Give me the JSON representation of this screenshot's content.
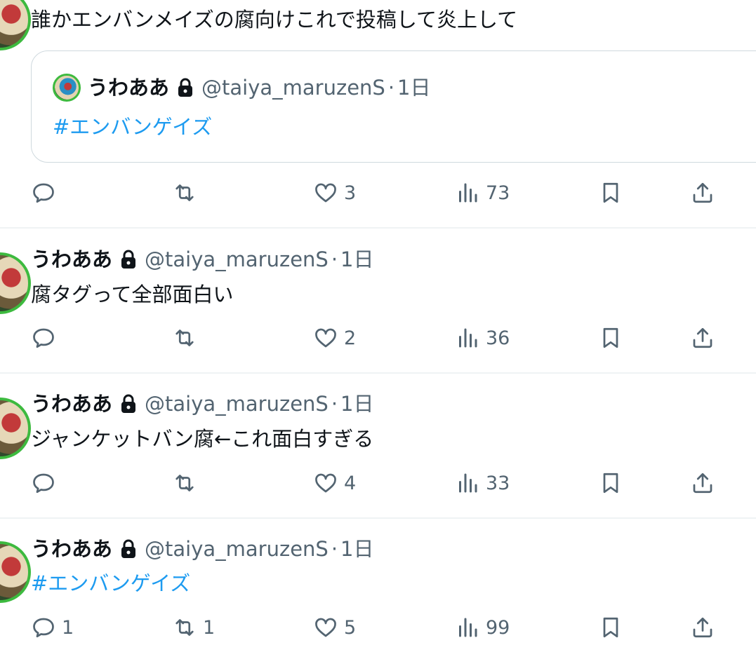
{
  "colors": {
    "text": "#0f1419",
    "secondary": "#536471",
    "hashtag": "#1d9bf0",
    "avatar_ring": "#3dba3f",
    "divider": "#eff3f4"
  },
  "post0": {
    "text": "誰かエンバンメイズの腐向けこれで投稿して炎上して",
    "quote": {
      "display_name": "うわああ",
      "handle": "@taiya_maruzenS",
      "sep": "·",
      "time": "1日",
      "text": "#エンバンゲイズ"
    },
    "reply_count": "",
    "retweet_count": "",
    "like_count": "3",
    "view_count": "73"
  },
  "post1": {
    "display_name": "うわああ",
    "handle": "@taiya_maruzenS",
    "sep": "·",
    "time": "1日",
    "text": "腐タグって全部面白い",
    "reply_count": "",
    "retweet_count": "",
    "like_count": "2",
    "view_count": "36"
  },
  "post2": {
    "display_name": "うわああ",
    "handle": "@taiya_maruzenS",
    "sep": "·",
    "time": "1日",
    "text": "ジャンケットバン腐←これ面白すぎる",
    "reply_count": "",
    "retweet_count": "",
    "like_count": "4",
    "view_count": "33"
  },
  "post3": {
    "display_name": "うわああ",
    "handle": "@taiya_maruzenS",
    "sep": "·",
    "time": "1日",
    "text": "#エンバンゲイズ",
    "reply_count": "1",
    "retweet_count": "1",
    "like_count": "5",
    "view_count": "99"
  },
  "icons": [
    "reply-icon",
    "retweet-icon",
    "like-icon",
    "views-icon",
    "bookmark-icon",
    "share-icon",
    "lock-icon"
  ]
}
